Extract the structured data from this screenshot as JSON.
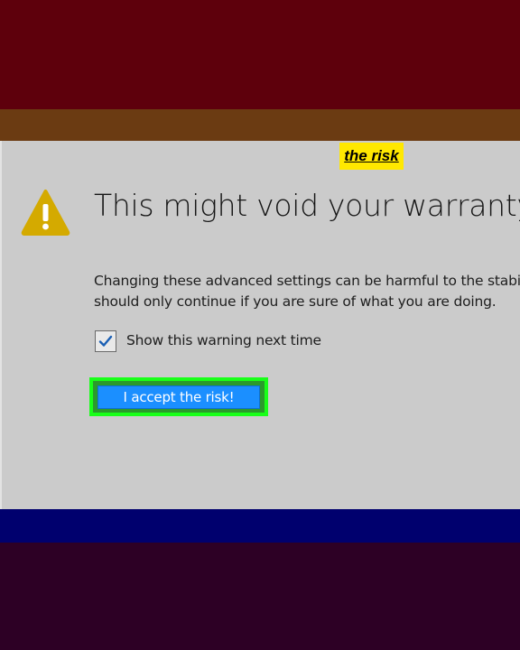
{
  "annotation": {
    "label": "the risk",
    "color": "#ffe800"
  },
  "dialog": {
    "icon": "warning-triangle-icon",
    "title": "This might void your warranty!",
    "description_lines": [
      "Changing these advanced settings can be harmful to the stability,",
      "should only continue if you are sure of what you are doing."
    ],
    "checkbox": {
      "label": "Show this warning next time",
      "checked": true
    },
    "accept_button": {
      "label": "I accept the risk!",
      "highlight_color": "#18ff18"
    }
  },
  "colors": {
    "top_band": "#5e000c",
    "brown_band": "#6b3b12",
    "panel": "#cbcbcb",
    "blue_band": "#00006e",
    "bottom_band": "#2d0025",
    "warning_icon": "#d4aa00",
    "button": "#1b8fff"
  }
}
